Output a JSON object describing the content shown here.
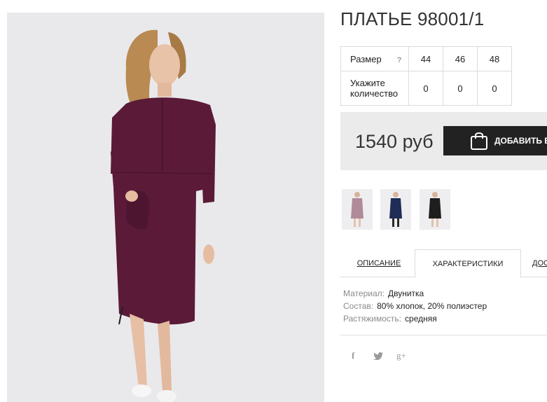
{
  "product": {
    "title": "ПЛАТЬЕ 98001/1",
    "dress_color": "#5a1a38"
  },
  "size_table": {
    "size_label": "Размер",
    "help_icon": "?",
    "sizes": [
      "44",
      "46",
      "48"
    ],
    "quantity_label": "Укажите количество",
    "quantities": [
      "0",
      "0",
      "0"
    ]
  },
  "buy": {
    "price": "1540 руб",
    "add_to_cart_label": "ДОБАВИТЬ В КОРЗИНУ"
  },
  "thumbnails": [
    {
      "icon": "dress-thumbnail-mauve",
      "color": "#b08a98"
    },
    {
      "icon": "dress-thumbnail-navy",
      "color": "#1f2d57"
    },
    {
      "icon": "dress-thumbnail-black",
      "color": "#1e1e1e"
    }
  ],
  "tabs": [
    {
      "label": "ОПИСАНИЕ"
    },
    {
      "label": "ХАРАКТЕРИСТИКИ"
    },
    {
      "label": "ДОСТАВКА"
    }
  ],
  "specs": [
    {
      "key": "Материал:",
      "value": "Двунитка"
    },
    {
      "key": "Состав:",
      "value": "80% хлопок, 20% полиэстер"
    },
    {
      "key": "Растяжимость:",
      "value": "средняя"
    }
  ],
  "social": {
    "facebook": "f",
    "twitter": "twitter-icon",
    "googleplus": "g+"
  }
}
